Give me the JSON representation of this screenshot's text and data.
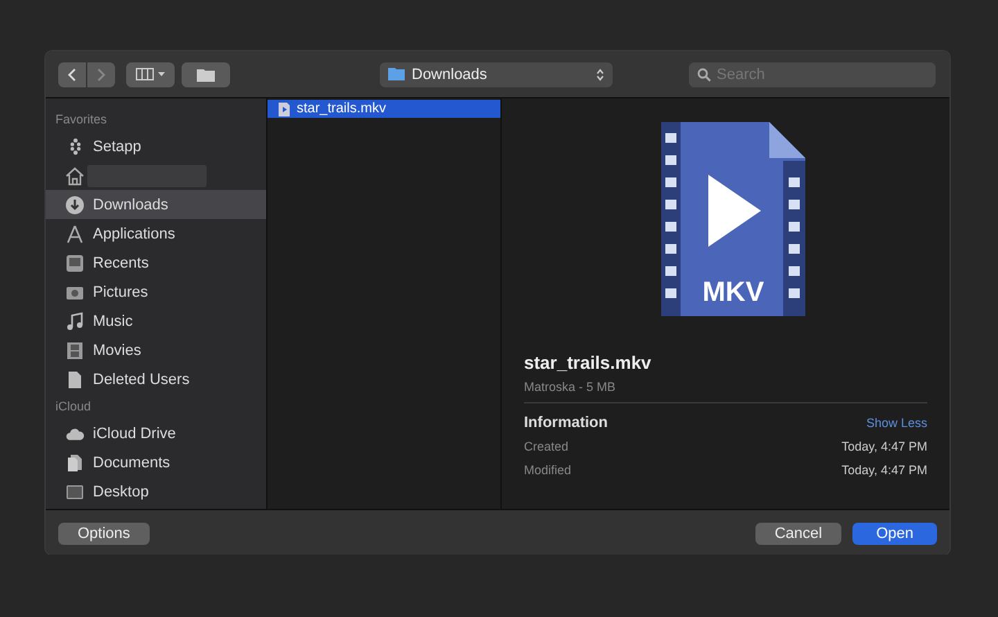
{
  "toolbar": {
    "location": "Downloads",
    "search": {
      "placeholder": "Search"
    }
  },
  "sidebar": {
    "sections": [
      {
        "title": "Favorites",
        "items": [
          {
            "kind": "setapp",
            "label": "Setapp",
            "selected": false
          },
          {
            "kind": "home",
            "selected": false
          },
          {
            "kind": "downloads",
            "label": "Downloads",
            "selected": true
          },
          {
            "kind": "applications",
            "label": "Applications",
            "selected": false
          },
          {
            "kind": "recents",
            "label": "Recents",
            "selected": false
          },
          {
            "kind": "pictures",
            "label": "Pictures",
            "selected": false
          },
          {
            "kind": "music",
            "label": "Music",
            "selected": false
          },
          {
            "kind": "movies",
            "label": "Movies",
            "selected": false
          },
          {
            "kind": "document",
            "label": "Deleted Users",
            "selected": false
          }
        ]
      },
      {
        "title": "iCloud",
        "items": [
          {
            "kind": "cloud",
            "label": "iCloud Drive",
            "selected": false
          },
          {
            "kind": "documents",
            "label": "Documents",
            "selected": false
          },
          {
            "kind": "desktop",
            "label": "Desktop",
            "selected": false
          }
        ]
      }
    ]
  },
  "files": [
    {
      "name": "star_trails.mkv",
      "selected": true
    }
  ],
  "preview": {
    "icon_label": "MKV",
    "name": "star_trails.mkv",
    "subtitle": "Matroska - 5 MB",
    "section_title": "Information",
    "toggle": "Show Less",
    "rows": [
      {
        "label": "Created",
        "value": "Today, 4:47 PM"
      },
      {
        "label": "Modified",
        "value": "Today, 4:47 PM"
      }
    ]
  },
  "buttons": {
    "options": "Options",
    "cancel": "Cancel",
    "open": "Open"
  }
}
